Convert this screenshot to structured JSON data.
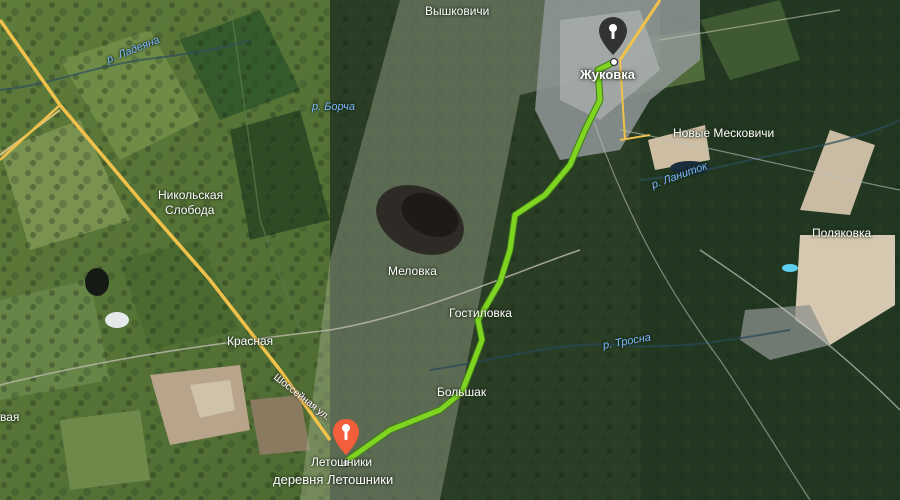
{
  "map": {
    "labels": {
      "vyshkovichi": "Вышковичи",
      "zhukovka": "Жуковка",
      "r_ladeyana": "р. Ладеяна",
      "r_borcha": "р. Борча",
      "novye_meskovichi": "Новые Месковичи",
      "r_lanitok": "р. Ланиток",
      "nikolskaya": "Никольская",
      "sloboda": "Слобода",
      "polyakovka": "Поляковка",
      "melovka": "Меловка",
      "gostilovka": "Гостиловка",
      "krasnaya": "Красная",
      "r_trosna": "р. Тросна",
      "bolshak": "Большак",
      "shosseynaya": "Шоссейная ул.",
      "letoshniki": "Летошники",
      "derevnya_letoshniki": "деревня Летошники",
      "vaya": "вая"
    },
    "markers": {
      "start": {
        "icon": "location-pin-icon",
        "color": "#f25f3a"
      },
      "end": {
        "icon": "location-pin-icon",
        "color": "#333333"
      }
    },
    "colors": {
      "route": "#7fd321",
      "route_outline": "#3f7a1a",
      "roads_major": "#f0c14b",
      "satellite_forest": "#243722",
      "satellite_field": "#5d7a3a"
    }
  }
}
